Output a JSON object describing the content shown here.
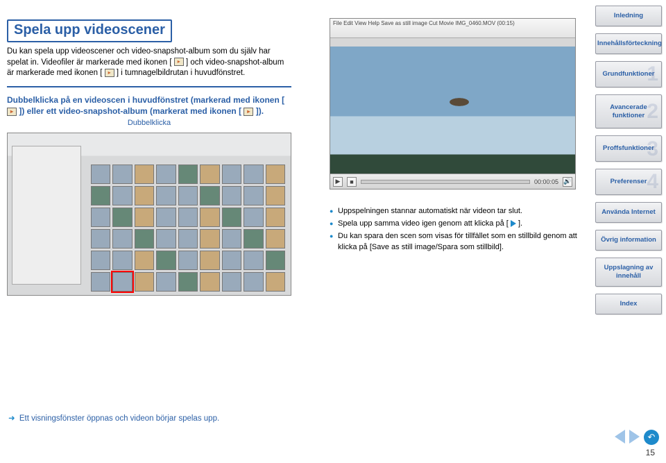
{
  "title": "Spela upp videoscener",
  "intro": {
    "p1a": "Du kan spela upp videoscener och video-snapshot-album som du själv har spelat in. Videofiler är markerade med ikonen [",
    "p1b": "] och video-snapshot-album är markerade med ikonen [",
    "p1c": "] i tumnagelbildrutan i huvudfönstret."
  },
  "instruction": {
    "a": "Dubbelklicka på en videoscen i huvudfönstret (markerad med ikonen [",
    "b": "]) eller ett video-snapshot-album (markerat med ikonen [",
    "c": "]).",
    "caption": "Dubbelklicka"
  },
  "bullets": {
    "b1": "Uppspelningen stannar automatiskt när videon tar slut.",
    "b2a": "Spela upp samma video igen genom att klicka på [",
    "b2b": "].",
    "b3": "Du kan spara den scen som visas för tillfället som en stillbild genom att klicka på [Save as still image/Spara som stillbild]."
  },
  "result_line": "Ett visningsfönster öppnas och videon börjar spelas upp.",
  "video": {
    "menubar": "File  Edit  View  Help    Save as still image   Cut Movie   IMG_0460.MOV (00:15)",
    "time": "00:00:05"
  },
  "sidebar": {
    "items": [
      "Inledning",
      "Innehållsförteckning",
      "Grundfunktioner",
      "Avancerade funktioner",
      "Proffsfunktioner",
      "Preferenser",
      "Använda Internet",
      "Övrig information",
      "Uppslagning av innehåll",
      "Index"
    ],
    "nums": [
      "",
      "",
      "1",
      "2",
      "3",
      "4",
      "",
      "",
      "",
      ""
    ]
  },
  "pagenum": "15"
}
